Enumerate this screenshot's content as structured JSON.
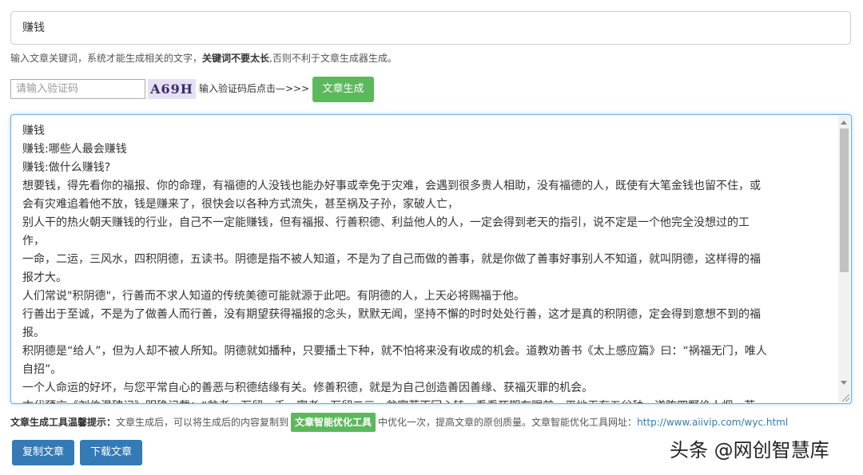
{
  "keyword": {
    "value": "赚钱"
  },
  "hint": {
    "prefix": "输入文章关键词，系统才能生成相关的文字，",
    "bold": "关键词不要太长",
    "suffix": ",否则不利于文章生成器生成。"
  },
  "captcha": {
    "placeholder": "请输入验证码",
    "code": "A69H",
    "tip": "输入验证码后点击—>>>",
    "generate_label": "文章生成"
  },
  "article": {
    "lines": [
      "赚钱",
      "赚钱:哪些人最会赚钱",
      "赚钱:做什么赚钱?",
      "想要钱，得先看你的福报、你的命理，有福德的人没钱也能办好事或幸免于灾难，会遇到很多贵人相助，没有福德的人，既使有大笔金钱也留不住，或",
      "会有灾难追着他不放，钱是赚来了，很快会以各种方式流失，甚至祸及子孙，家破人亡，",
      "别人干的热火朝天赚钱的行业，自己不一定能赚钱，但有福报、行善积德、利益他人的人，一定会得到老天的指引，说不定是一个他完全没想过的工",
      "作，",
      "一命，二运，三风水，四积阴德，五读书。阴德是指不被人知道，不是为了自己而做的善事，就是你做了善事好事别人不知道，就叫阴德，这样得的福",
      "报才大。",
      "人们常说\"积阴德\"，行善而不求人知道的传统美德可能就源于此吧。有阴德的人，上天必将赐福于他。",
      "行善出于至诚，不是为了做善人而行善，没有期望获得福报的念头，默默无闻，坚持不懈的时时处处行善，这才是真的积阴德，定会得到意想不到的福",
      "报。",
      "积阴德是“给人”，但为人却不被人所知。阴德就如播种，只要播土下种，就不怕将来没有收成的机会。道教劝善书《太上感应篇》曰：“祸福无门，唯人",
      "自招”。",
      "一个人命运的好坏，与您平常自心的善恶与积德结缘有关。修善积德，就是为自己创造善因善缘、获福灭罪的机会。",
      "古代预言《刘伯温碑记》明确记载：“贫者一万留一千，富者一万留二三，贫富若不回心转，看看死期在眼前，平地无有五谷种，遂陈四野绝人烟，若"
    ]
  },
  "tips": {
    "label": "文章生成工具温馨提示：",
    "text1": "文章生成后，可以将生成后的内容复制到",
    "tool_name": "文章智能优化工具",
    "text2": "中优化一次，提高文章的原创质量。文章智能优化工具网址：",
    "url": "http://www.aiivip.com/wyc.html"
  },
  "actions": {
    "copy_label": "复制文章",
    "download_label": "下载文章"
  },
  "watermark": "头条 @网创智慧库"
}
